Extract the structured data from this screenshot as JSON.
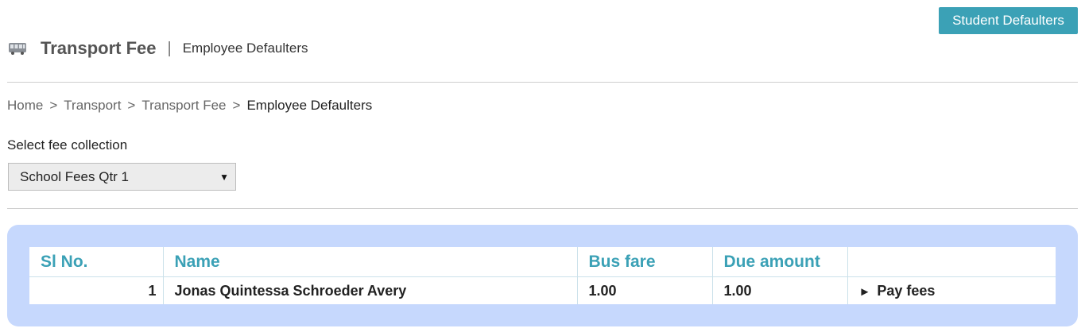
{
  "header": {
    "title": "Transport Fee",
    "separator": "|",
    "subtitle": "Employee Defaulters",
    "icon": "bus-icon",
    "student_defaulters_label": "Student Defaulters"
  },
  "breadcrumb": {
    "items": [
      "Home",
      "Transport",
      "Transport Fee"
    ],
    "current": "Employee Defaulters",
    "separator": ">"
  },
  "fee_collection": {
    "label": "Select fee collection",
    "selected": "School Fees Qtr 1"
  },
  "table": {
    "headers": [
      "Sl No.",
      "Name",
      "Bus fare",
      "Due amount",
      ""
    ],
    "rows": [
      {
        "sl_no": "1",
        "name": "Jonas Quintessa Schroeder Avery",
        "bus_fare": "1.00",
        "due_amount": "1.00",
        "action": "Pay fees"
      }
    ]
  },
  "colors": {
    "accent": "#3ba1b6",
    "panel": "#c6d8fd"
  }
}
